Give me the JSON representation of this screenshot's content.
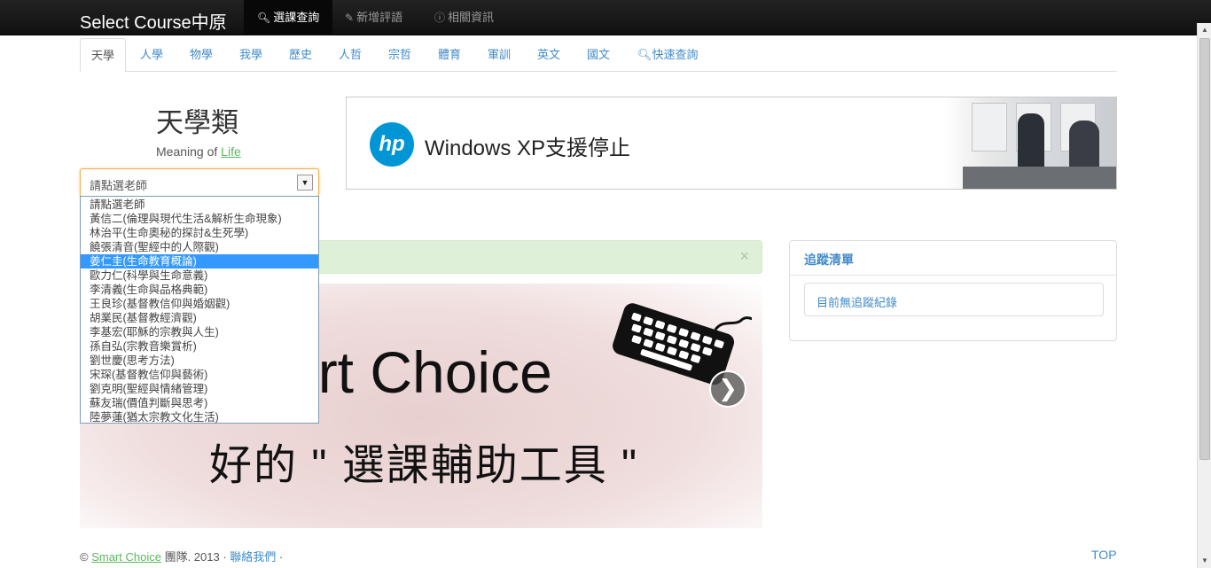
{
  "navbar": {
    "brand": "Select Course中原",
    "items": [
      {
        "label": "選課查詢",
        "icon": "search-icon"
      },
      {
        "label": "新增評語",
        "icon": "pencil-icon"
      },
      {
        "label": "相關資訊",
        "icon": "info-icon"
      }
    ]
  },
  "tabs": [
    "天學",
    "人學",
    "物學",
    "我學",
    "歷史",
    "人哲",
    "宗哲",
    "體育",
    "軍訓",
    "英文",
    "國文",
    "快速查詢"
  ],
  "category": {
    "title": "天學類",
    "meaning_prefix": "Meaning of ",
    "meaning_link": "Life"
  },
  "teacher_select": {
    "selected": "請點選老師",
    "options": [
      "請點選老師",
      "黃信二(倫理與現代生活&解析生命現象)",
      "林治平(生命奧秘的探討&生死學)",
      "饒張清音(聖經中的人際觀)",
      "姜仁圭(生命教育概論)",
      "歐力仁(科學與生命意義)",
      "李清義(生命與品格典範)",
      "王良珍(基督教信仰與婚姻觀)",
      "胡業民(基督教經濟觀)",
      "李基宏(耶穌的宗教與人生)",
      "孫自弘(宗教音樂賞析)",
      "劉世慶(思考方法)",
      "宋琛(基督教信仰與藝術)",
      "劉克明(聖經與情緒管理)",
      "蘇友瑞(價值判斷與思考)",
      "陸夢蓮(猶太宗教文化生活)"
    ],
    "highlighted_index": 4
  },
  "ad": {
    "logo": "hp",
    "text": "Windows XP支援停止"
  },
  "alert": {
    "close": "×"
  },
  "banner": {
    "title": "art Choice",
    "subtitle": "好的 \" 選課輔助工具 \"",
    "next": "❯"
  },
  "tracking": {
    "heading": "追蹤清單",
    "empty": "目前無追蹤紀錄"
  },
  "footer": {
    "copyright": "© ",
    "link": "Smart Choice",
    "text": " 團隊. 2013 · ",
    "contact": "聯絡我們",
    "dot": " ·",
    "top": "TOP"
  },
  "colors": {
    "navbar": "#111111",
    "link": "#428bca",
    "green_link": "#5cb85c",
    "alert_bg": "#dff0d8",
    "selected_option": "#3399ff"
  }
}
